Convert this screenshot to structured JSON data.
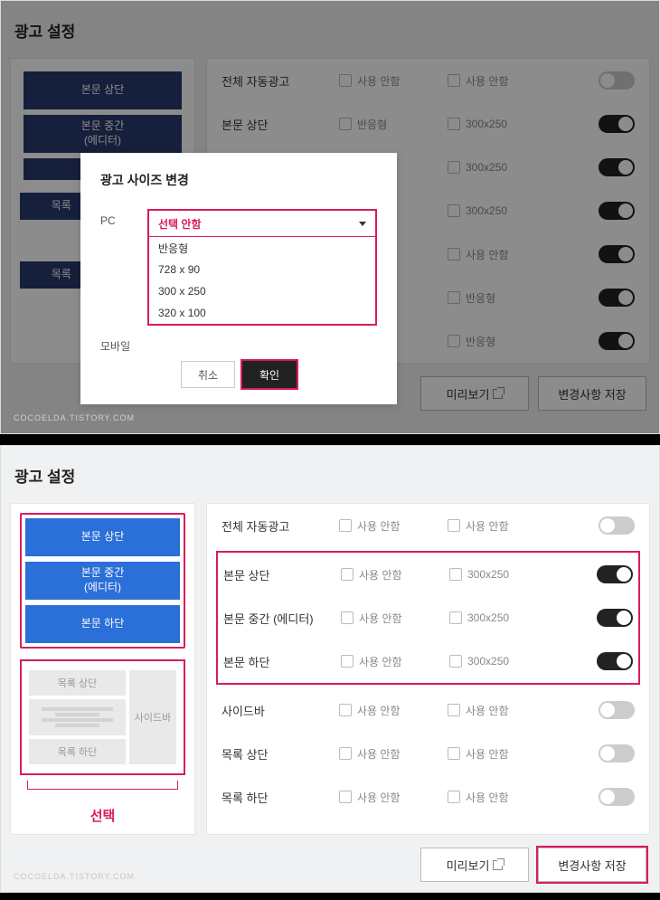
{
  "page_title": "광고 설정",
  "watermark": "COCOELDA.TISTORY.COM",
  "sidebar": {
    "buttons": [
      {
        "label": "본문 상단"
      },
      {
        "label": "본문 중간\n(에디터)"
      },
      {
        "label": "본문 하단"
      },
      {
        "label": "목록 상단"
      },
      {
        "label": "목록 하단"
      }
    ]
  },
  "layout_preview": {
    "top": "목록 상단",
    "side": "사이드바",
    "bottom": "목록 하단"
  },
  "select_label": "선택",
  "settings": {
    "rows_top": [
      {
        "label": "전체 자동광고",
        "opt1": "사용 안함",
        "opt2": "사용 안함",
        "on": false
      },
      {
        "label": "본문 상단",
        "opt1": "반응형",
        "opt2": "300x250",
        "on": true
      },
      {
        "label": "",
        "opt1": "",
        "opt2": "300x250",
        "on": true
      },
      {
        "label": "",
        "opt1": "",
        "opt2": "300x250",
        "on": true
      },
      {
        "label": "",
        "opt1": "",
        "opt2": "사용 안함",
        "on": true
      },
      {
        "label": "",
        "opt1": "",
        "opt2": "반응형",
        "on": true
      },
      {
        "label": "",
        "opt1": "",
        "opt2": "반응형",
        "on": true
      }
    ],
    "row_auto": {
      "label": "전체 자동광고",
      "opt1": "사용 안함",
      "opt2": "사용 안함",
      "on": false
    },
    "rows_highlighted": [
      {
        "label": "본문 상단",
        "opt1": "사용 안함",
        "opt2": "300x250",
        "on": true
      },
      {
        "label": "본문 중간 (에디터)",
        "opt1": "사용 안함",
        "opt2": "300x250",
        "on": true
      },
      {
        "label": "본문 하단",
        "opt1": "사용 안함",
        "opt2": "300x250",
        "on": true
      }
    ],
    "rows_after": [
      {
        "label": "사이드바",
        "opt1": "사용 안함",
        "opt2": "사용 안함",
        "on": false
      },
      {
        "label": "목록 상단",
        "opt1": "사용 안함",
        "opt2": "사용 안함",
        "on": false
      },
      {
        "label": "목록 하단",
        "opt1": "사용 안함",
        "opt2": "사용 안함",
        "on": false
      }
    ]
  },
  "footer": {
    "preview": "미리보기",
    "save": "변경사항 저장"
  },
  "modal": {
    "title": "광고 사이즈 변경",
    "label_pc": "PC",
    "label_mobile": "모바일",
    "selected": "선택 안함",
    "options": [
      "반응형",
      "728 x 90",
      "300 x 250",
      "320 x 100"
    ],
    "cancel": "취소",
    "confirm": "확인"
  }
}
